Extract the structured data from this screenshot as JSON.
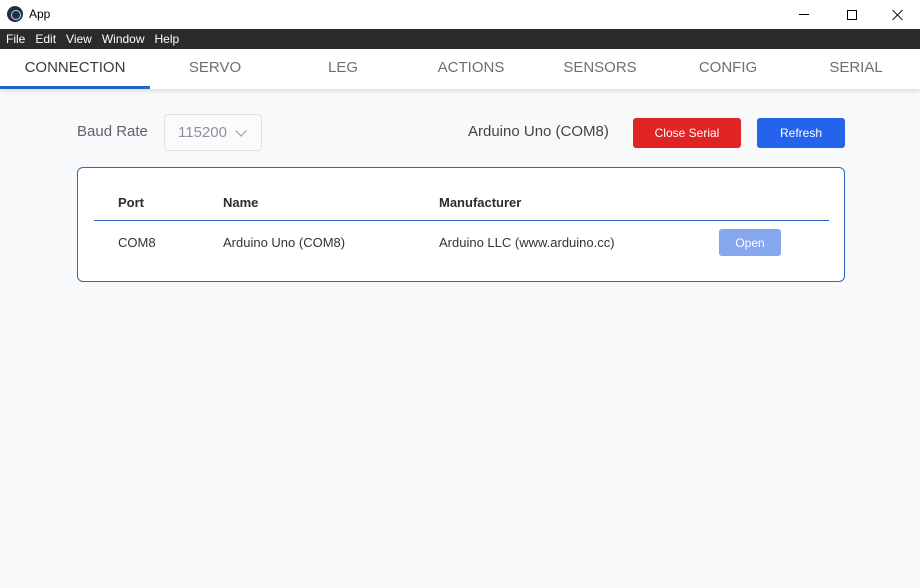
{
  "window": {
    "title": "App"
  },
  "menu": [
    "File",
    "Edit",
    "View",
    "Window",
    "Help"
  ],
  "tabs": [
    "CONNECTION",
    "SERVO",
    "LEG",
    "ACTIONS",
    "SENSORS",
    "CONFIG",
    "SERIAL"
  ],
  "active_tab": "CONNECTION",
  "baud": {
    "label": "Baud Rate",
    "value": "115200"
  },
  "connected_device": "Arduino Uno (COM8)",
  "buttons": {
    "close_serial": "Close Serial",
    "refresh": "Refresh"
  },
  "colors": {
    "accent": "#2563eb",
    "danger": "#e02424",
    "open_button": "#86a7ee",
    "menubar": "#2b2b2b"
  },
  "table": {
    "headers": [
      "Port",
      "Name",
      "Manufacturer"
    ],
    "rows": [
      {
        "port": "COM8",
        "name": "Arduino Uno (COM8)",
        "manufacturer": "Arduino LLC (www.arduino.cc)",
        "action": "Open"
      }
    ]
  }
}
